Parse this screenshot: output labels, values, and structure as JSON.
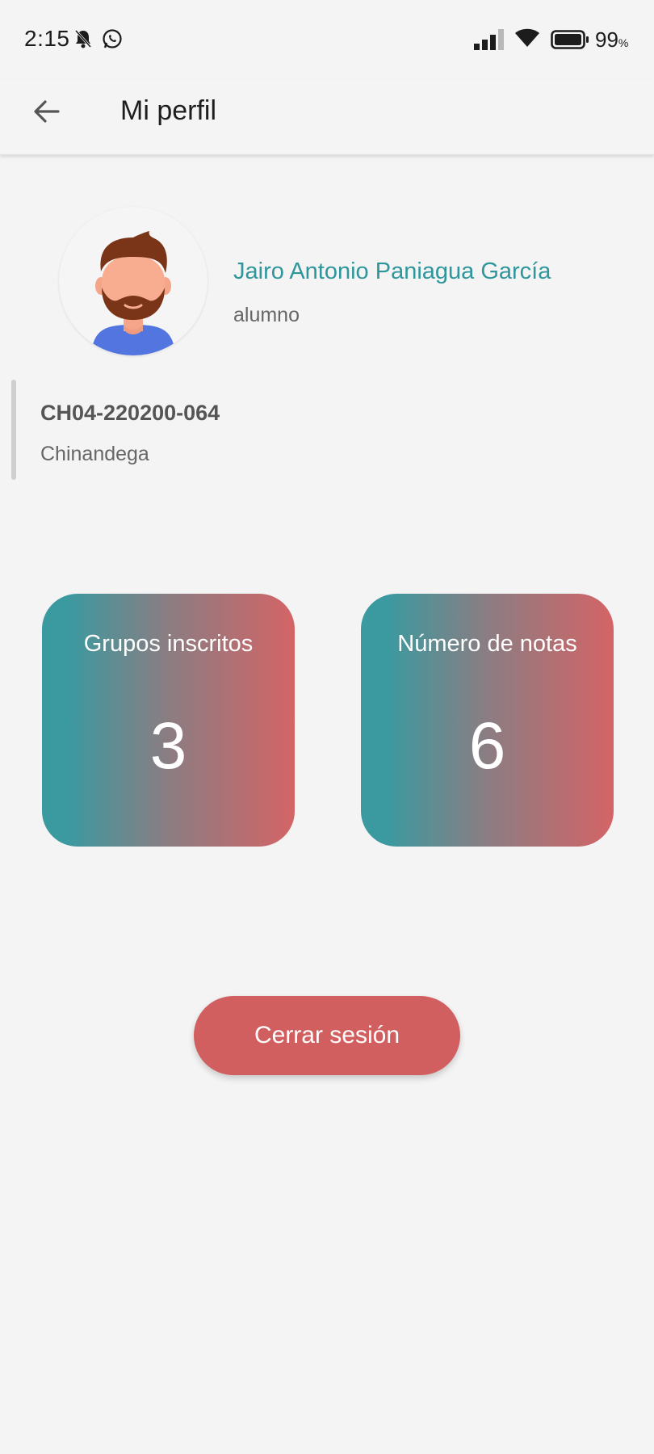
{
  "status_bar": {
    "time": "2:15",
    "battery": "99",
    "battery_unit": "%",
    "icons": [
      "bell-off-icon",
      "whatsapp-icon",
      "signal-icon",
      "wifi-icon",
      "battery-icon"
    ]
  },
  "app_bar": {
    "title": "Mi perfil",
    "back_icon": "arrow-left-icon"
  },
  "profile": {
    "name": "Jairo Antonio Paniagua García",
    "role": "alumno",
    "code": "CH04-220200-064",
    "city": "Chinandega"
  },
  "stats": [
    {
      "label": "Grupos inscritos",
      "value": "3"
    },
    {
      "label": "Número de notas",
      "value": "6"
    }
  ],
  "actions": {
    "logout_label": "Cerrar sesión"
  },
  "colors": {
    "accent_teal": "#2f969b",
    "card_gradient_start": "#3a9aa0",
    "card_gradient_end": "#d46466",
    "logout_button": "#d15f5f"
  }
}
